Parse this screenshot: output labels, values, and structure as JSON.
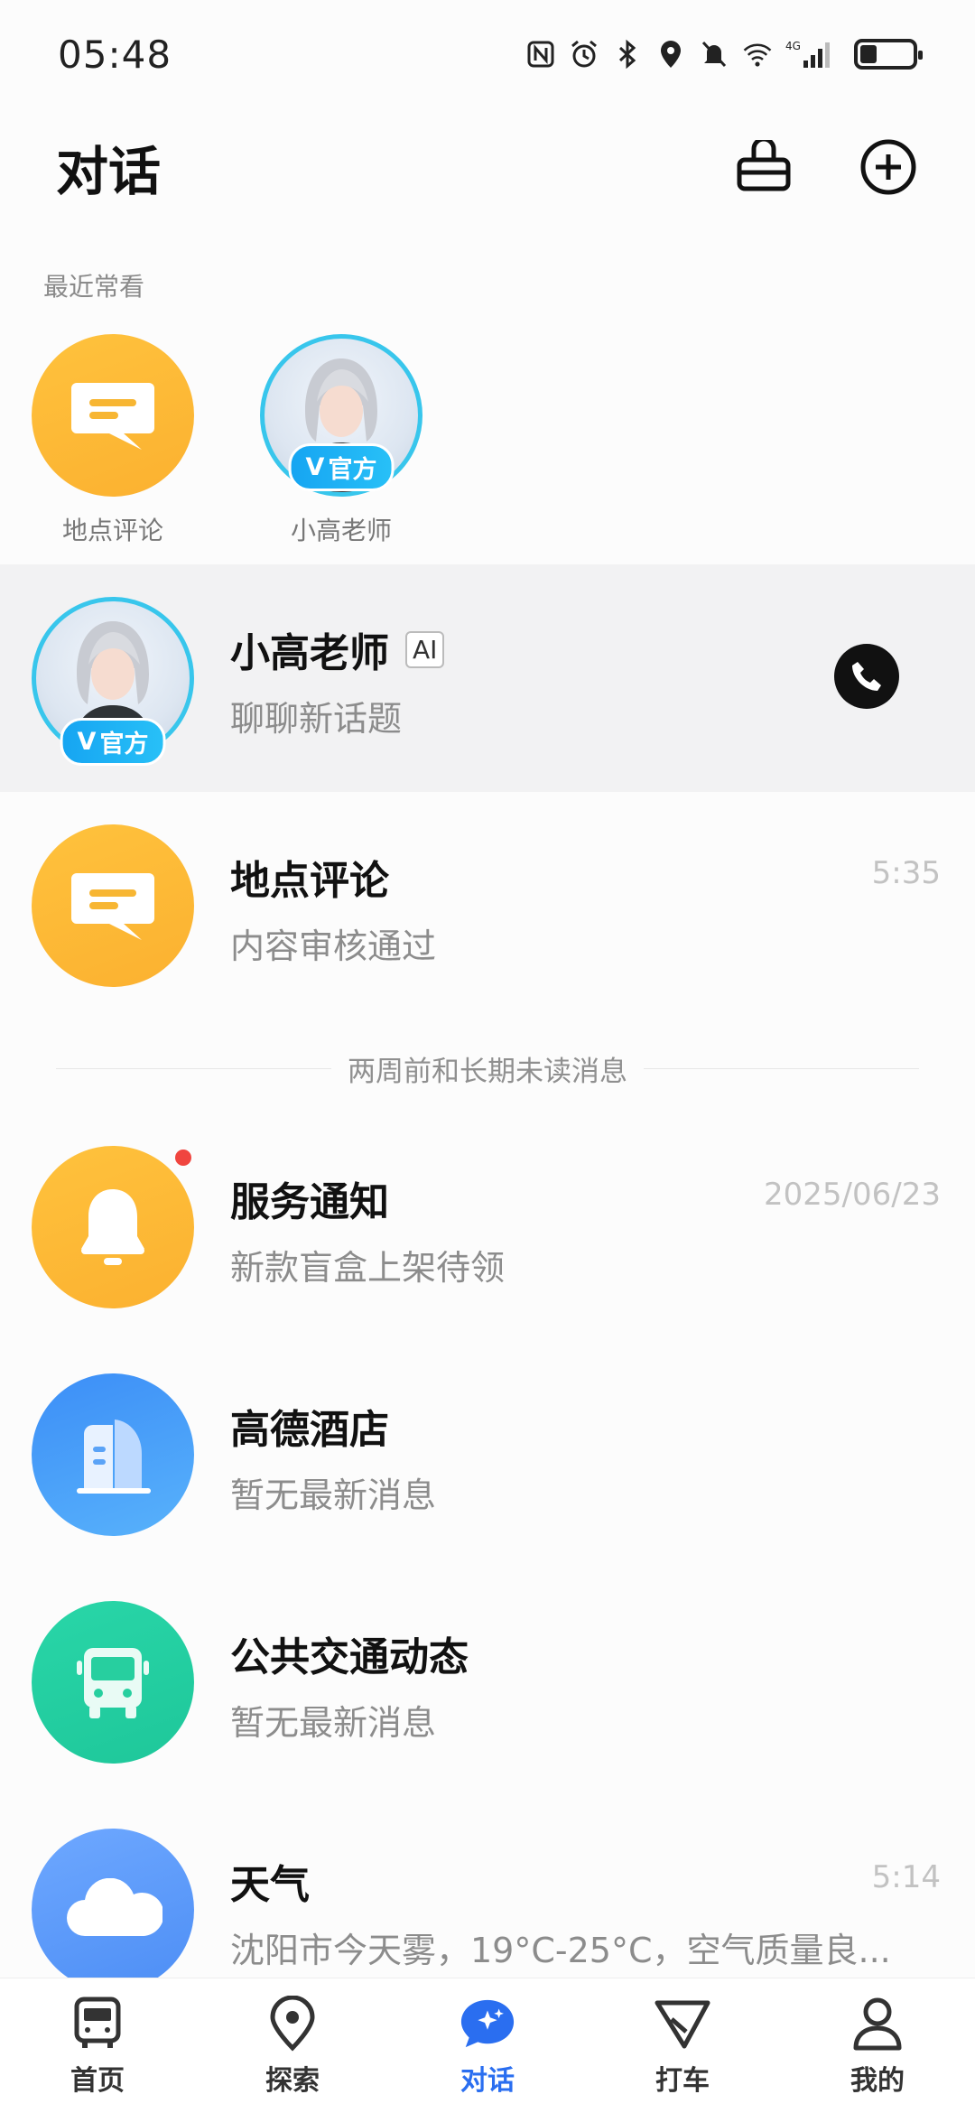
{
  "status": {
    "time": "05:48",
    "network": "4G"
  },
  "header": {
    "title": "对话"
  },
  "recent": {
    "label": "最近常看",
    "items": [
      {
        "label": "地点评论",
        "icon": "comment-icon"
      },
      {
        "label": "小高老师",
        "badge": "官方",
        "icon": "teacher-avatar"
      }
    ]
  },
  "conversations": [
    {
      "title": "小高老师",
      "tag": "AI",
      "subtitle": "聊聊新话题",
      "badge": "官方",
      "time": ""
    },
    {
      "title": "地点评论",
      "subtitle": "内容审核通过",
      "time": "5:35"
    },
    {
      "title": "服务通知",
      "subtitle": "新款盲盒上架待领",
      "time": "2025/06/23",
      "unread": true
    },
    {
      "title": "高德酒店",
      "subtitle": "暂无最新消息",
      "time": ""
    },
    {
      "title": "公共交通动态",
      "subtitle": "暂无最新消息",
      "time": ""
    },
    {
      "title": "天气",
      "subtitle": "沈阳市今天雾，19°C-25°C，空气质量良...",
      "time": "5:14"
    }
  ],
  "divider": "两周前和长期未读消息",
  "nav": [
    {
      "label": "首页",
      "icon": "bus-home-icon"
    },
    {
      "label": "探索",
      "icon": "location-pin-icon"
    },
    {
      "label": "对话",
      "icon": "chat-sparkle-icon",
      "active": true
    },
    {
      "label": "打车",
      "icon": "taxi-icon"
    },
    {
      "label": "我的",
      "icon": "person-icon"
    }
  ],
  "colors": {
    "accent": "#2a6ef0",
    "orange": "#fbb130",
    "blue": "#3c8ef7",
    "green": "#1ec79a",
    "unread": "#f0453f"
  }
}
